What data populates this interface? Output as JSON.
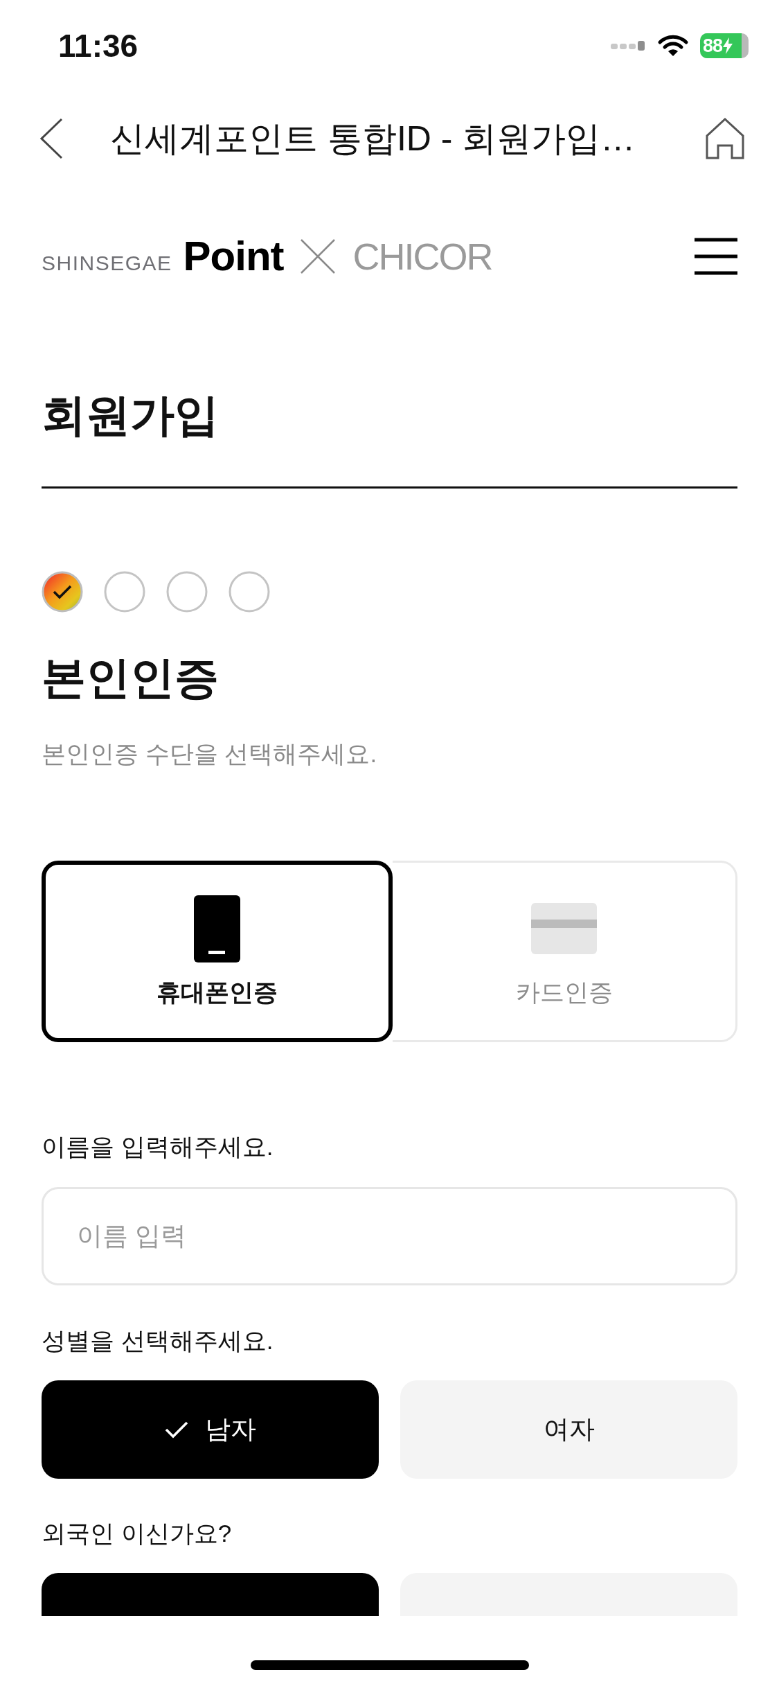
{
  "status_bar": {
    "time": "11:36",
    "battery": "88"
  },
  "nav_bar": {
    "title": "신세계포인트 통합ID - 회원가입…"
  },
  "brand": {
    "prefix": "SHINSEGAE",
    "name": "Point",
    "partner": "CHICOR"
  },
  "page_title": "회원가입",
  "steps": [
    {
      "completed": true
    },
    {
      "completed": false
    },
    {
      "completed": false
    },
    {
      "completed": false
    }
  ],
  "section": {
    "title": "본인인증",
    "subtitle": "본인인증 수단을 선택해주세요."
  },
  "auth_methods": [
    {
      "kind": "phone",
      "label": "휴대폰인증",
      "selected": true
    },
    {
      "kind": "card",
      "label": "카드인증",
      "selected": false
    }
  ],
  "name_field": {
    "label": "이름을 입력해주세요.",
    "placeholder": "이름 입력"
  },
  "gender": {
    "label": "성별을 선택해주세요.",
    "options": [
      {
        "label": "남자",
        "selected": true
      },
      {
        "label": "여자",
        "selected": false
      }
    ]
  },
  "nationality": {
    "label": "외국인 이신가요?",
    "options": [
      {
        "selected": true
      },
      {
        "selected": false
      }
    ]
  }
}
